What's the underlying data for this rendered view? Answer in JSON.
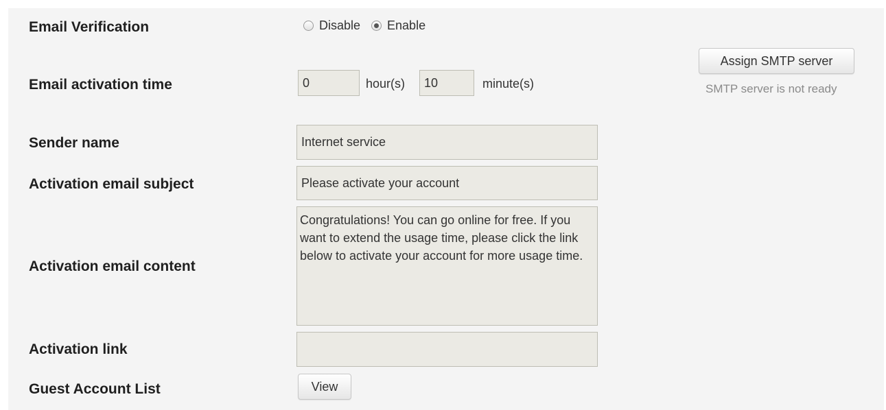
{
  "email_verification": {
    "label": "Email Verification",
    "options": [
      {
        "label": "Disable",
        "checked": false
      },
      {
        "label": "Enable",
        "checked": true
      }
    ]
  },
  "activation_time": {
    "label": "Email activation time",
    "hours_value": "0",
    "hours_unit": "hour(s)",
    "minutes_value": "10",
    "minutes_unit": "minute(s)"
  },
  "smtp": {
    "button_label": "Assign SMTP server",
    "status_text": "SMTP server is not ready"
  },
  "sender_name": {
    "label": "Sender name",
    "value": "Internet service"
  },
  "subject": {
    "label": "Activation email subject",
    "value": "Please activate your account"
  },
  "content": {
    "label": "Activation email content",
    "value": "Congratulations! You can go online for free. If you want to extend the usage time, please click the link below to activate your account for more usage time."
  },
  "activation_link": {
    "label": "Activation link",
    "value": ""
  },
  "guest_list": {
    "label": "Guest Account List",
    "button_label": "View"
  }
}
